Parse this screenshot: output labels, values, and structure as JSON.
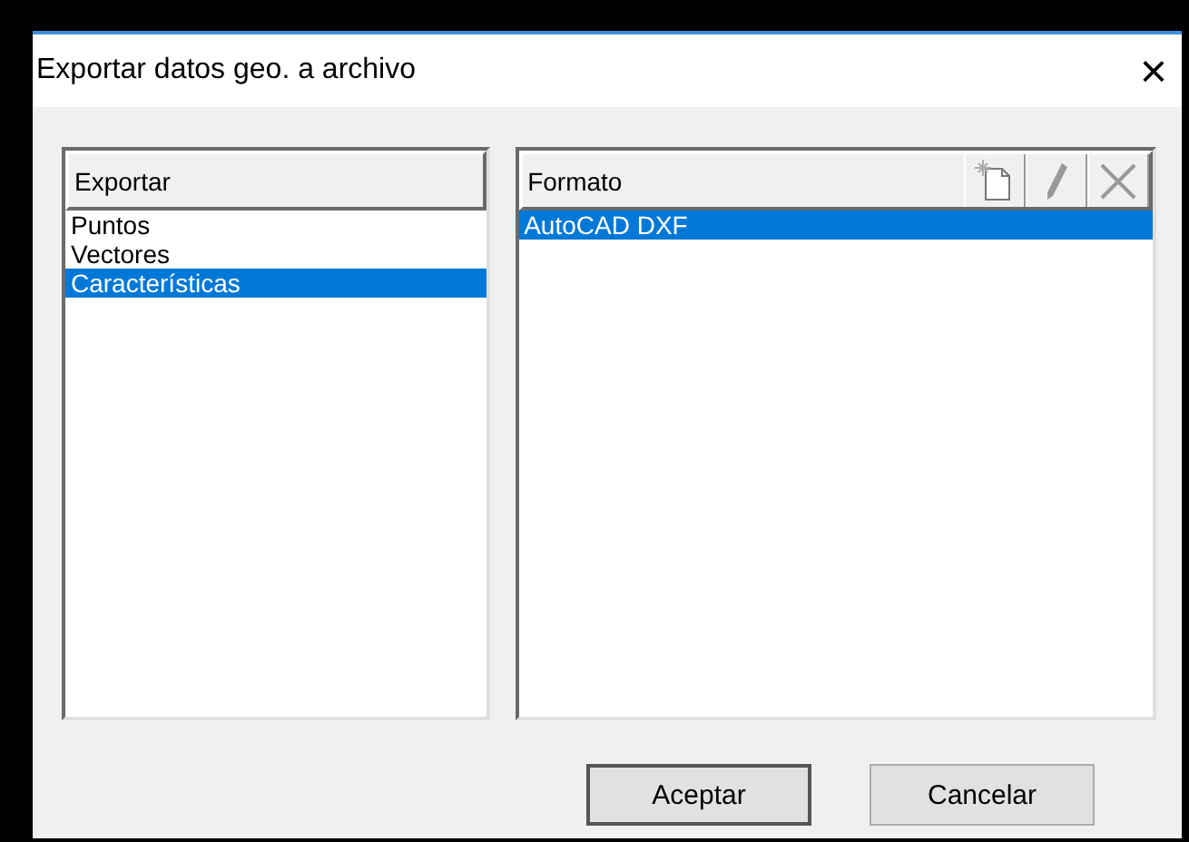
{
  "window": {
    "title": "Exportar datos geo. a archivo",
    "close": "×"
  },
  "export_list": {
    "header": "Exportar",
    "items": [
      {
        "label": "Puntos",
        "selected": false
      },
      {
        "label": "Vectores",
        "selected": false
      },
      {
        "label": "Características",
        "selected": true
      }
    ]
  },
  "format_list": {
    "header": "Formato",
    "items": [
      {
        "label": "AutoCAD DXF",
        "selected": true
      }
    ]
  },
  "buttons": [
    {
      "label": "Aceptar",
      "default": true
    },
    {
      "label": "Cancelar",
      "default": false
    }
  ]
}
